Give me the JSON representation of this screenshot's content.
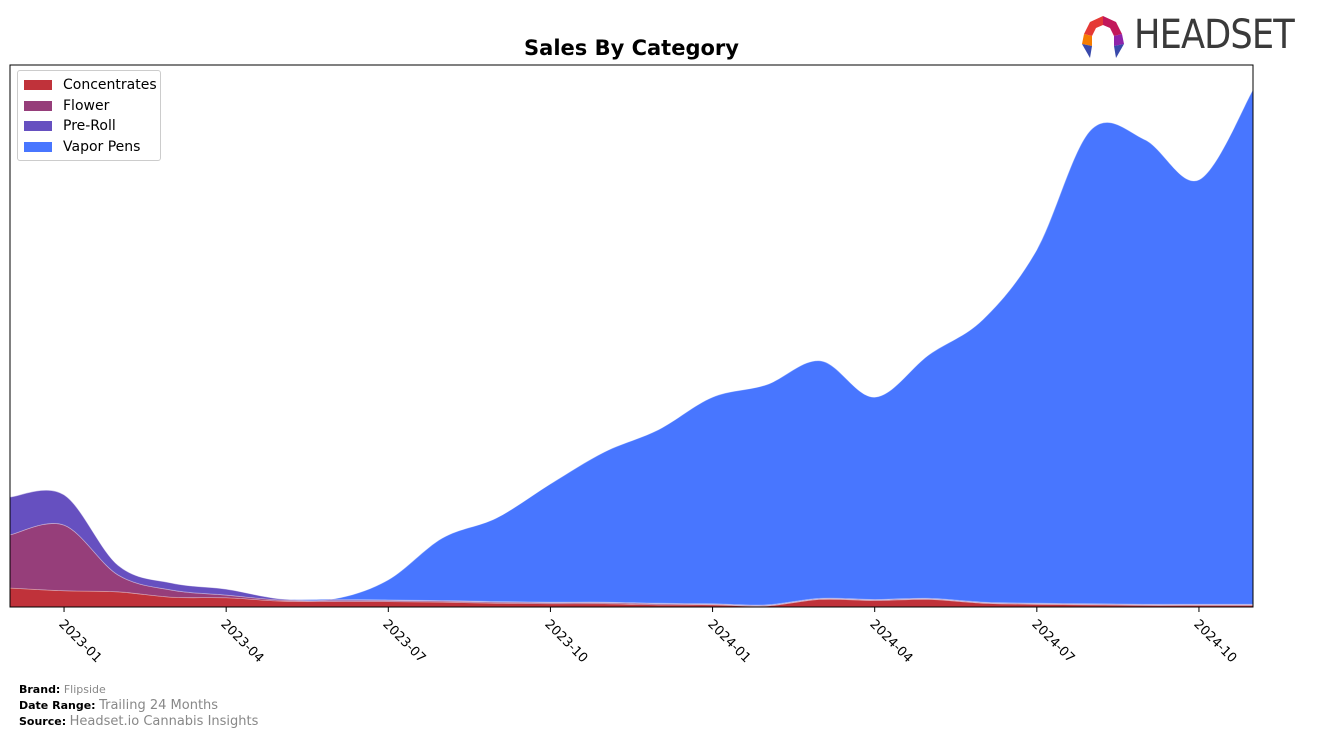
{
  "header": {
    "logo_text": "HEADSET"
  },
  "chart_data": {
    "type": "area",
    "stacked": true,
    "title": "Sales By Category",
    "xlabel": "",
    "ylabel": "",
    "y_axis_visible": false,
    "grid": false,
    "legend_position": "top-left",
    "x": [
      "2022-12",
      "2023-01",
      "2023-02",
      "2023-03",
      "2023-04",
      "2023-05",
      "2023-06",
      "2023-07",
      "2023-08",
      "2023-09",
      "2023-10",
      "2023-11",
      "2023-12",
      "2024-01",
      "2024-02",
      "2024-03",
      "2024-04",
      "2024-05",
      "2024-06",
      "2024-07",
      "2024-08",
      "2024-09",
      "2024-10",
      "2024-11"
    ],
    "x_tick_labels": [
      "2023-01",
      "2023-04",
      "2023-07",
      "2023-10",
      "2024-01",
      "2024-04",
      "2024-07",
      "2024-10"
    ],
    "ylim": [
      0,
      100
    ],
    "series": [
      {
        "name": "Concentrates",
        "color": "#c0323a",
        "values": [
          3.5,
          3.0,
          2.8,
          1.8,
          1.7,
          1.1,
          1.0,
          1.0,
          0.9,
          0.7,
          0.6,
          0.6,
          0.4,
          0.4,
          0.2,
          1.4,
          1.2,
          1.4,
          0.7,
          0.5,
          0.4,
          0.3,
          0.3,
          0.3
        ]
      },
      {
        "name": "Flower",
        "color": "#963e7a",
        "values": [
          9.8,
          12.1,
          3.1,
          1.3,
          0.5,
          0.2,
          0.2,
          0.2,
          0.2,
          0.2,
          0.2,
          0.2,
          0.2,
          0.1,
          0.1,
          0.1,
          0.1,
          0.1,
          0.1,
          0.1,
          0.1,
          0.1,
          0.1,
          0.1
        ]
      },
      {
        "name": "Pre-Roll",
        "color": "#6650c0",
        "values": [
          7.0,
          5.6,
          1.8,
          1.3,
          1.1,
          0.2,
          0.2,
          0.1,
          0.1,
          0.1,
          0.1,
          0.1,
          0.1,
          0.1,
          0.1,
          0.1,
          0.1,
          0.1,
          0.1,
          0.1,
          0.1,
          0.1,
          0.1,
          0.1
        ]
      },
      {
        "name": "Vapor Pens",
        "color": "#4876ff",
        "values": [
          0.0,
          0.0,
          0.0,
          0.0,
          0.0,
          0.0,
          0.1,
          3.7,
          11.5,
          15.4,
          21.8,
          27.7,
          32.0,
          38.1,
          40.6,
          43.8,
          37.3,
          44.9,
          52.1,
          65.2,
          87.4,
          85.7,
          78.3,
          94.9
        ]
      }
    ]
  },
  "footer": {
    "brand_label": "Brand:",
    "brand_value": "Flipside",
    "date_range_label": "Date Range:",
    "date_range_value": "Trailing 24 Months",
    "source_label": "Source:",
    "source_value": "Headset.io Cannabis Insights"
  }
}
